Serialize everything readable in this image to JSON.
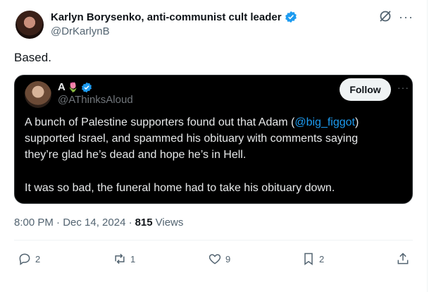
{
  "author": {
    "display_name": "Karlyn Borysenko, anti-communist cult leader",
    "handle": "@DrKarlynB",
    "verified_color": "#1d9bf0"
  },
  "tweet": {
    "text": "Based.",
    "timestamp": "8:00 PM · Dec 14, 2024 ·",
    "views_count": "815",
    "views_label": "Views"
  },
  "quote": {
    "display_name": "A",
    "name_emojis": "🌷",
    "handle": "@AThinksAloud",
    "follow_label": "Follow",
    "line1": "A bunch of Palestine supporters found out that Adam (",
    "mention": "@big_figgot",
    "line1_end": ")",
    "line2": "supported Israel, and spammed his obituary with comments saying",
    "line3": "they’re glad he’s dead and hope he’s in Hell.",
    "line4": "It was so bad, the funeral home had to take his obituary down."
  },
  "actions": {
    "replies": "2",
    "reposts": "1",
    "likes": "9",
    "bookmarks": "2"
  },
  "colors": {
    "accent": "#1d9bf0",
    "muted": "#536471",
    "quote_bg": "#000000"
  }
}
